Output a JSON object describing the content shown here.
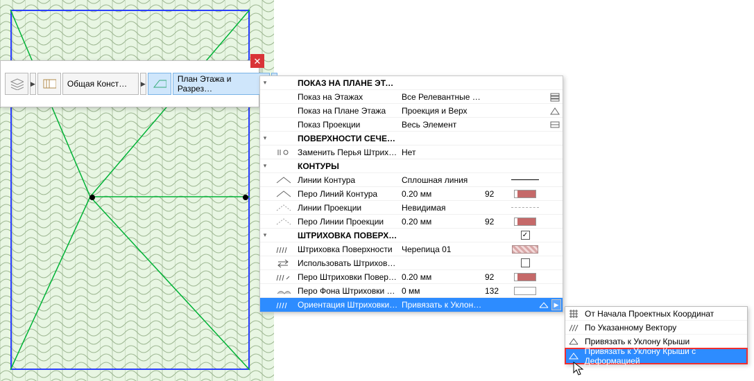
{
  "toolbar": {
    "general_label": "Общая Конст…",
    "plan_label": "План Этажа и Разрез…"
  },
  "sections": {
    "floorplan": {
      "title": "ПОКАЗ НА ПЛАНЕ ЭТАЖА",
      "show_on_stories": {
        "label": "Показ на Этажах",
        "value": "Все Релевантные Э…"
      },
      "display": {
        "label": "Показ на Плане Этажа",
        "value": "Проекция и Верх"
      },
      "show_projection": {
        "label": "Показ Проекции",
        "value": "Весь Элемент"
      }
    },
    "cut": {
      "title": "ПОВЕРХНОСТИ СЕЧЕНИЯ",
      "override": {
        "label": "Заменить Перья Штрихо…",
        "value": "Нет"
      }
    },
    "outlines": {
      "title": "КОНТУРЫ",
      "contour_lines": {
        "label": "Линии Контура",
        "value": "Сплошная линия"
      },
      "contour_pen": {
        "label": "Перо Линий Контура",
        "value": "0.20 мм",
        "pen": "92"
      },
      "proj_lines": {
        "label": "Линии Проекции",
        "value": "Невидимая"
      },
      "proj_pen": {
        "label": "Перо Линии Проекции",
        "value": "0.20 мм",
        "pen": "92"
      }
    },
    "cover": {
      "title": "ШТРИХОВКА ПОВЕРХНОСТЕЙ",
      "fill": {
        "label": "Штриховка Поверхности",
        "value": "Черепица 01"
      },
      "use": {
        "label": "Использовать Штриховк…"
      },
      "fill_pen": {
        "label": "Перо Штриховки Поверх…",
        "value": "0.20 мм",
        "pen": "92"
      },
      "bg_pen": {
        "label": "Перо Фона Штриховки П…",
        "value": "0 мм",
        "pen": "132"
      },
      "orient": {
        "label": "Ориентация Штриховки …",
        "value": "Привязать к Уклон…"
      }
    }
  },
  "ctx": {
    "items": [
      "От Начала Проектных Координат",
      "По Указанному Вектору",
      "Привязать к Уклону Крыши",
      "Привязать к Уклону Крыши с Деформацией"
    ]
  },
  "chart_data": null
}
